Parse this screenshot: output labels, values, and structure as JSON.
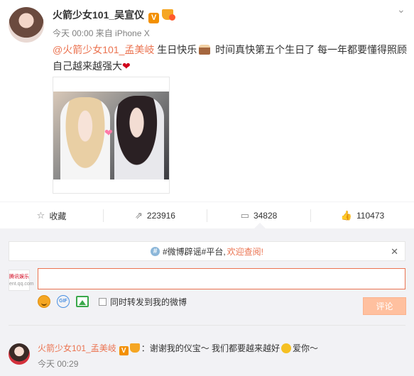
{
  "post": {
    "username": "火箭少女101_吴宣仪",
    "verified_badge": "V",
    "meta": "今天 00:00 来自 iPhone X",
    "mention": "@火箭少女101_孟美岐",
    "text_1": " 生日快乐",
    "text_2": " 时间真快第五个生日了  每一年都要懂得照顾自己越来越强大",
    "icons": {
      "menu": "chevron-down-icon",
      "cake": "cake-emoji",
      "heart": "heart-emoji"
    }
  },
  "actions": [
    {
      "icon": "star-icon",
      "label": "收藏"
    },
    {
      "icon": "repost-icon",
      "label": "223916"
    },
    {
      "icon": "comment-icon",
      "label": "34828"
    },
    {
      "icon": "like-icon",
      "label": "110473"
    }
  ],
  "notice": {
    "icon": "info-icon",
    "text": "#微博辟谣#平台, ",
    "highlight": "欢迎查阅!",
    "close": "✕"
  },
  "composer": {
    "avatar_line1": "腾讯娱乐",
    "avatar_line2": "ent.qq.com",
    "input_value": "",
    "repost_label": "同时转发到我的微博",
    "submit_label": "评论"
  },
  "comment": {
    "username": "火箭少女101_孟美岐",
    "verified_badge": "V",
    "text_1": "：谢谢我的仪宝～ 我们都要越来越好",
    "text_2": "爱你～",
    "time": "今天 00:29"
  },
  "colors": {
    "accent": "#eb7350",
    "verified": "#f39000",
    "submit_disabled": "#ffc09f",
    "background": "#f2f2f5"
  }
}
